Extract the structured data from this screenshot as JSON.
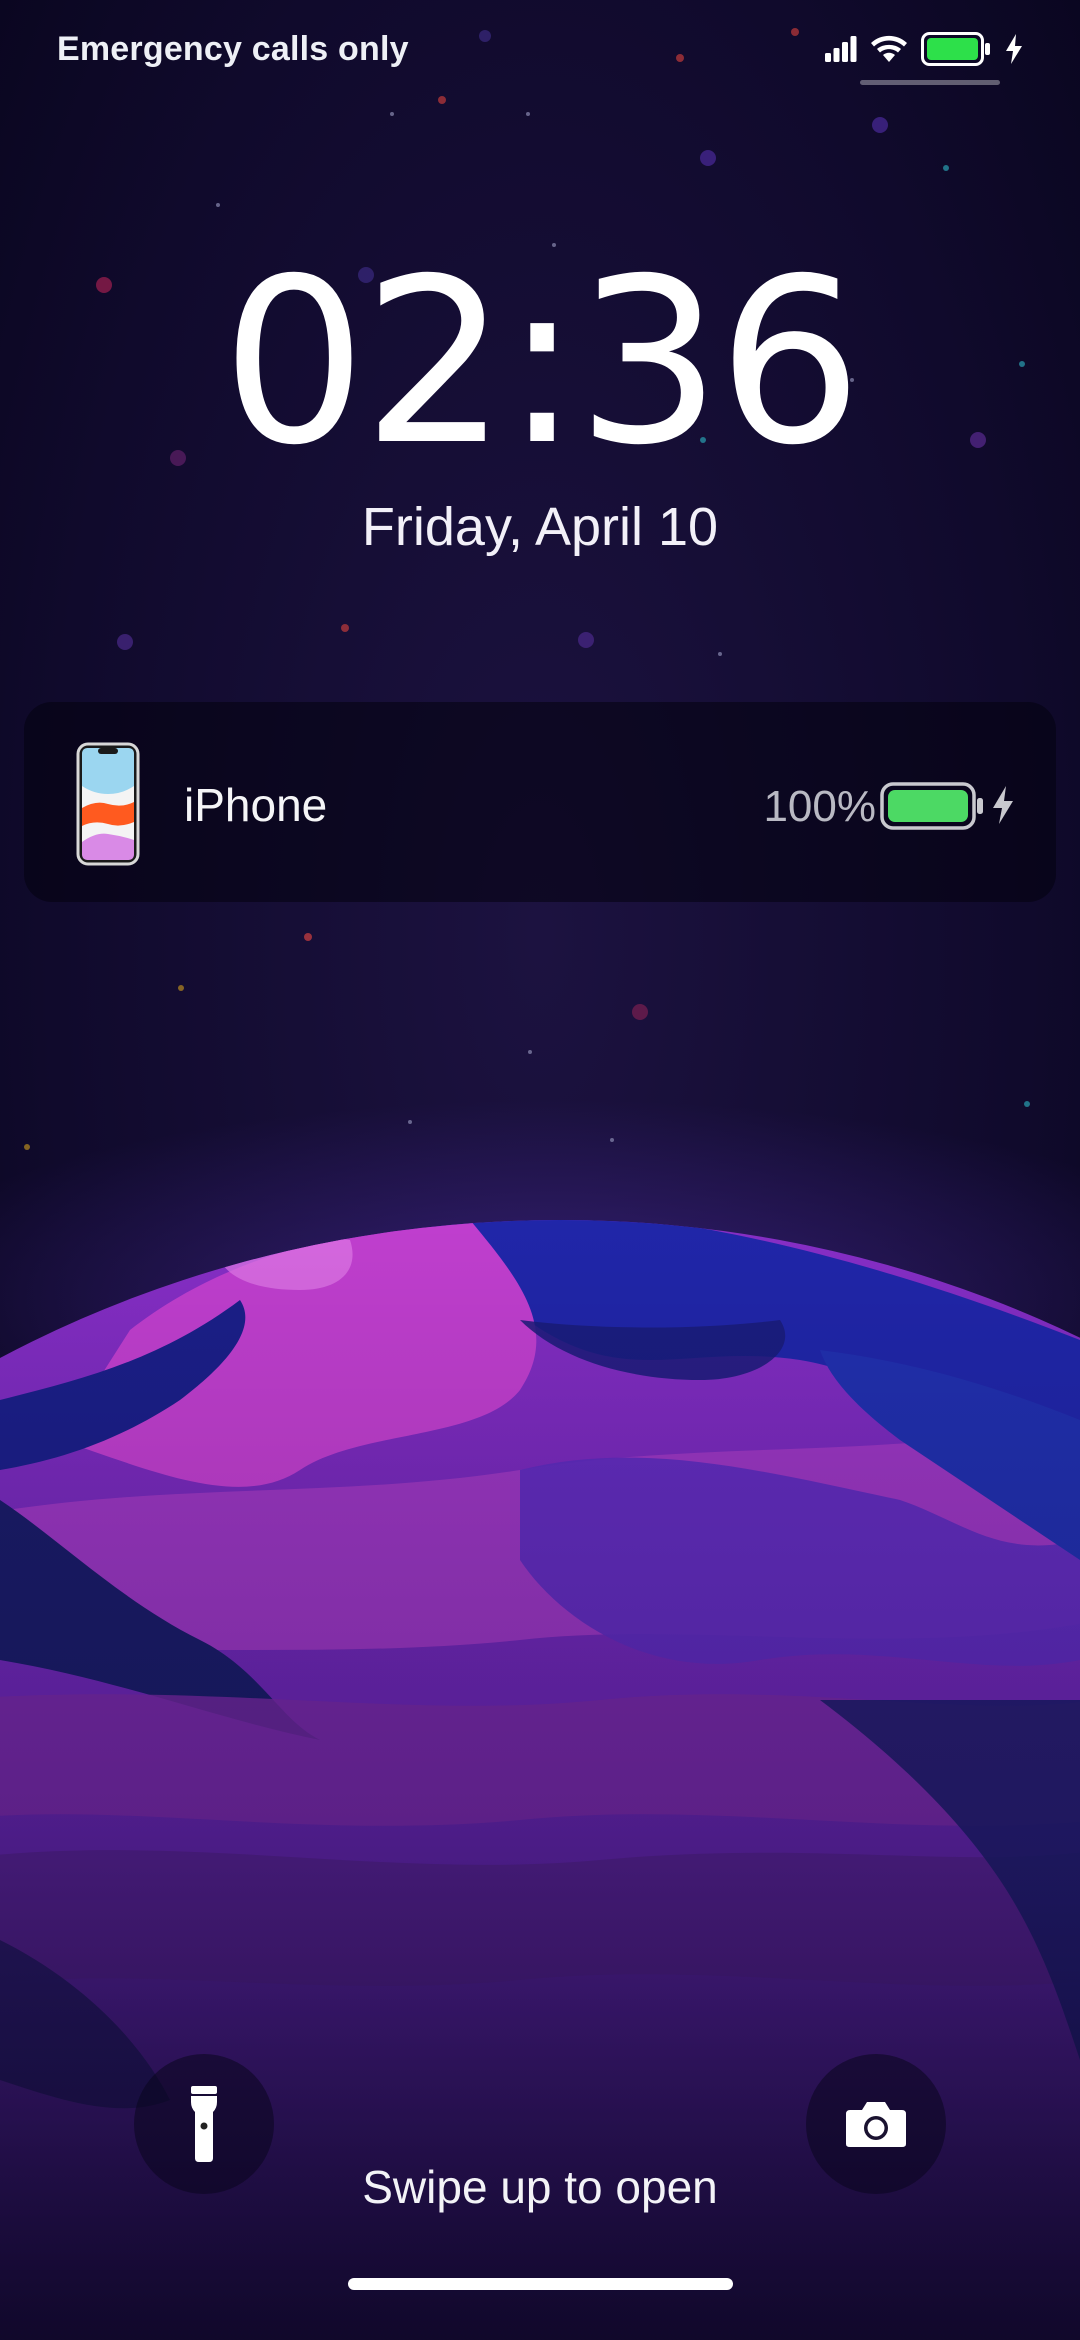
{
  "status_bar": {
    "carrier_text": "Emergency calls only",
    "icons": [
      "signal-icon",
      "wifi-icon",
      "battery-icon",
      "charging-bolt-icon"
    ],
    "battery_color": "#2de04a"
  },
  "lock_screen": {
    "time": "02:36",
    "date": "Friday, April 10"
  },
  "battery_widget": {
    "device_name": "iPhone",
    "percentage": "100%",
    "level": 1.0,
    "battery_color": "#4cd964",
    "charging": true
  },
  "quick_actions": {
    "left": "flashlight-icon",
    "right": "camera-icon"
  },
  "swipe_hint": "Swipe up to open",
  "colors": {
    "background": "#0d0825",
    "planet_magenta": "#b23ad0",
    "planet_blue": "#2028a8"
  }
}
